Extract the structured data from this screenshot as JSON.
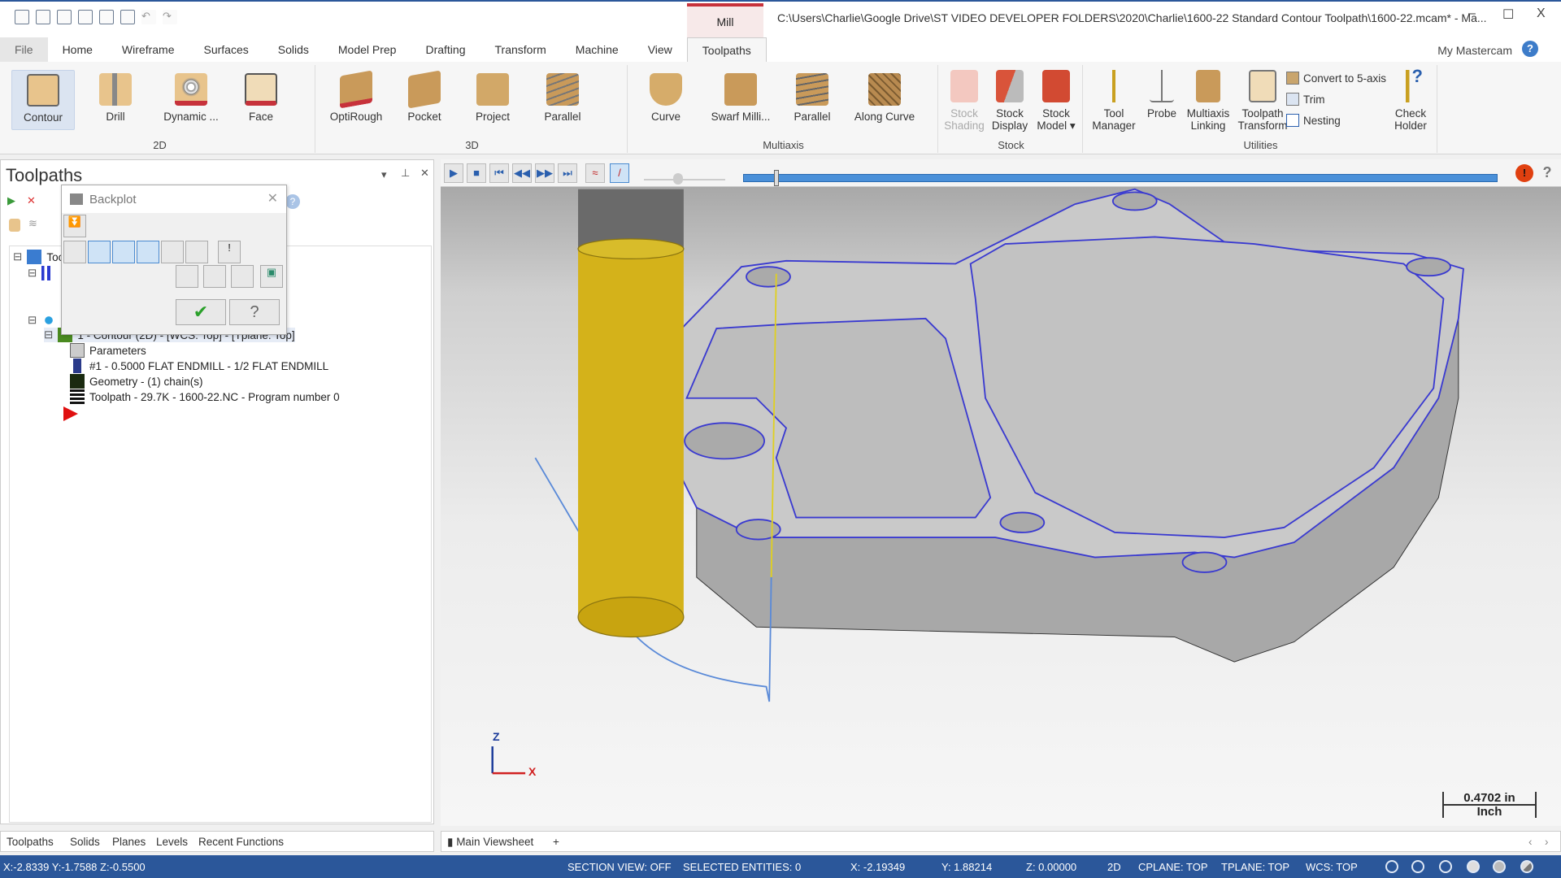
{
  "titlebar": {
    "context_tab": "Mill",
    "title": "C:\\Users\\Charlie\\Google Drive\\ST VIDEO DEVELOPER FOLDERS\\2020\\Charlie\\1600-22 Standard Contour Toolpath\\1600-22.mcam* - Ma...",
    "minimize": "–",
    "maximize": "☐",
    "close": "X"
  },
  "tabs": [
    "File",
    "Home",
    "Wireframe",
    "Surfaces",
    "Solids",
    "Model Prep",
    "Drafting",
    "Transform",
    "Machine",
    "View",
    "Toolpaths"
  ],
  "active_tab": "Toolpaths",
  "my_mastercam": "My Mastercam",
  "help": "?",
  "ribbon": {
    "groups": [
      "2D",
      "3D",
      "Multiaxis",
      "Stock",
      "Utilities"
    ],
    "g2d": [
      "Contour",
      "Drill",
      "Dynamic ...",
      "Face"
    ],
    "g3d": [
      "OptiRough",
      "Pocket",
      "Project",
      "Parallel"
    ],
    "gmulti": [
      "Curve",
      "Swarf Milli...",
      "Parallel",
      "Along Curve"
    ],
    "stock": [
      [
        "Stock",
        "Shading"
      ],
      [
        "Stock",
        "Display"
      ],
      [
        "Stock",
        "Model ▾"
      ]
    ],
    "util": [
      [
        "Tool",
        "Manager"
      ],
      [
        "Probe",
        ""
      ],
      [
        "Multiaxis",
        "Linking"
      ],
      [
        "Toolpath",
        "Transform"
      ]
    ],
    "util_small": [
      "Convert to 5-axis",
      "Trim",
      "Nesting"
    ],
    "check_holder": [
      "Check",
      "Holder"
    ]
  },
  "panel": {
    "title": "Toolpaths",
    "tree": {
      "root": "Toolpaths",
      "operation": "1 - Contour (2D) - [WCS: Top] - [Tplane: Top]",
      "children": [
        "Parameters",
        "#1 - 0.5000 FLAT ENDMILL -  1/2 FLAT ENDMILL",
        "Geometry - (1) chain(s)",
        "Toolpath - 29.7K - 1600-22.NC - Program number 0"
      ]
    }
  },
  "backplot": {
    "title": "Backplot",
    "close": "✕",
    "ok": "✔",
    "help": "?"
  },
  "playback": {
    "progress_percent": 4
  },
  "viewport": {
    "axis_z": "Z",
    "axis_x": "X",
    "scale_value": "0.4702 in",
    "scale_unit": "Inch",
    "colors": {
      "tool": "#d4b21a",
      "toolpath": "#3a3ad0",
      "part": "#c8c8c8"
    }
  },
  "bottom_tabs": [
    "Toolpaths",
    "Solids",
    "Planes",
    "Levels",
    "Recent Functions"
  ],
  "viewsheet": {
    "label": "Main Viewsheet",
    "add": "+"
  },
  "status": {
    "cursor": "X:-2.8339  Y:-1.7588  Z:-0.5500",
    "section": "SECTION VIEW: OFF",
    "selected": "SELECTED ENTITIES: 0",
    "x": "X:   -2.19349",
    "y": "Y:   1.88214",
    "z": "Z:   0.00000",
    "mode": "2D",
    "cplane": "CPLANE: TOP",
    "tplane": "TPLANE: TOP",
    "wcs": "WCS: TOP"
  }
}
